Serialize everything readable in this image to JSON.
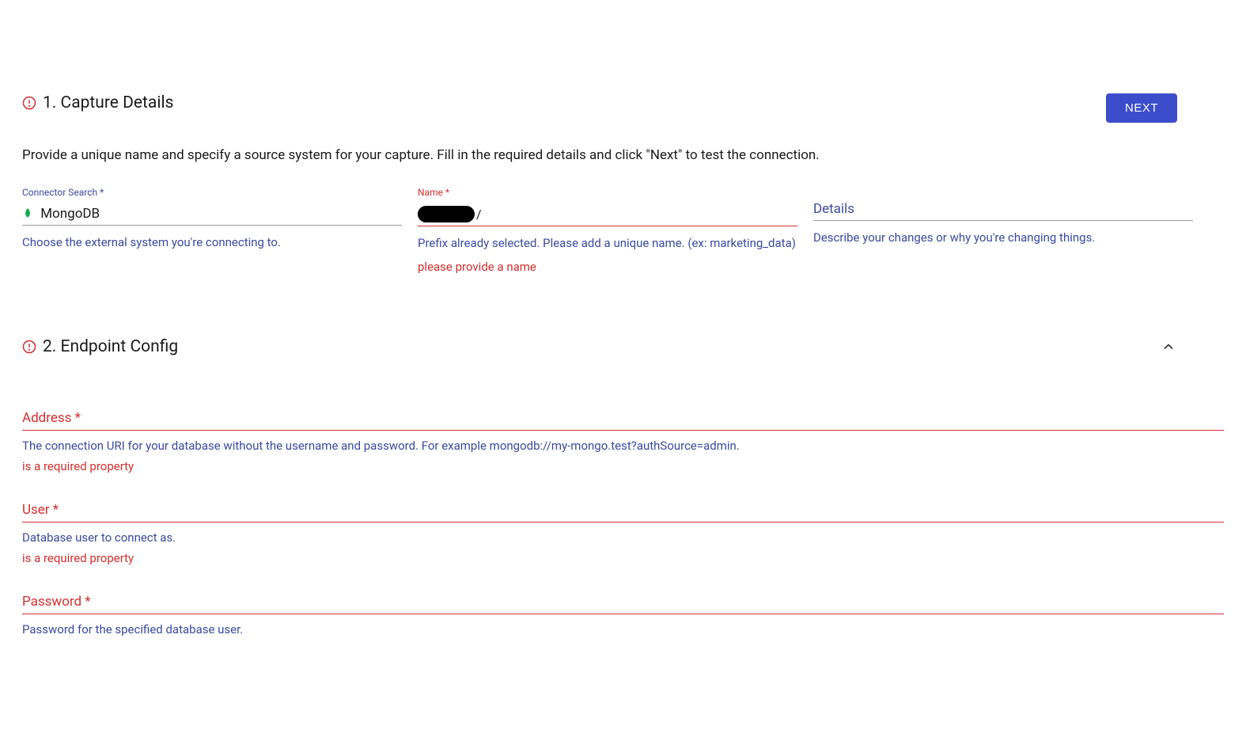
{
  "header": {
    "next_button": "NEXT"
  },
  "section1": {
    "title": "1. Capture Details",
    "description": "Provide a unique name and specify a source system for your capture. Fill in the required details and click \"Next\" to test the connection.",
    "connector": {
      "label": "Connector Search *",
      "value": "MongoDB",
      "helper": "Choose the external system you're connecting to."
    },
    "name": {
      "label": "Name *",
      "suffix": "/",
      "helper": "Prefix already selected. Please add a unique name. (ex: marketing_data)",
      "error": "please provide a name"
    },
    "details": {
      "placeholder": "Details",
      "helper": "Describe your changes or why you're changing things."
    }
  },
  "section2": {
    "title": "2. Endpoint Config",
    "address": {
      "label": "Address *",
      "helper": "The connection URI for your database without the username and password. For example mongodb://my-mongo.test?authSource=admin.",
      "error": "is a required property"
    },
    "user": {
      "label": "User *",
      "helper": "Database user to connect as.",
      "error": "is a required property"
    },
    "password": {
      "label": "Password *",
      "helper": "Password for the specified database user."
    }
  }
}
